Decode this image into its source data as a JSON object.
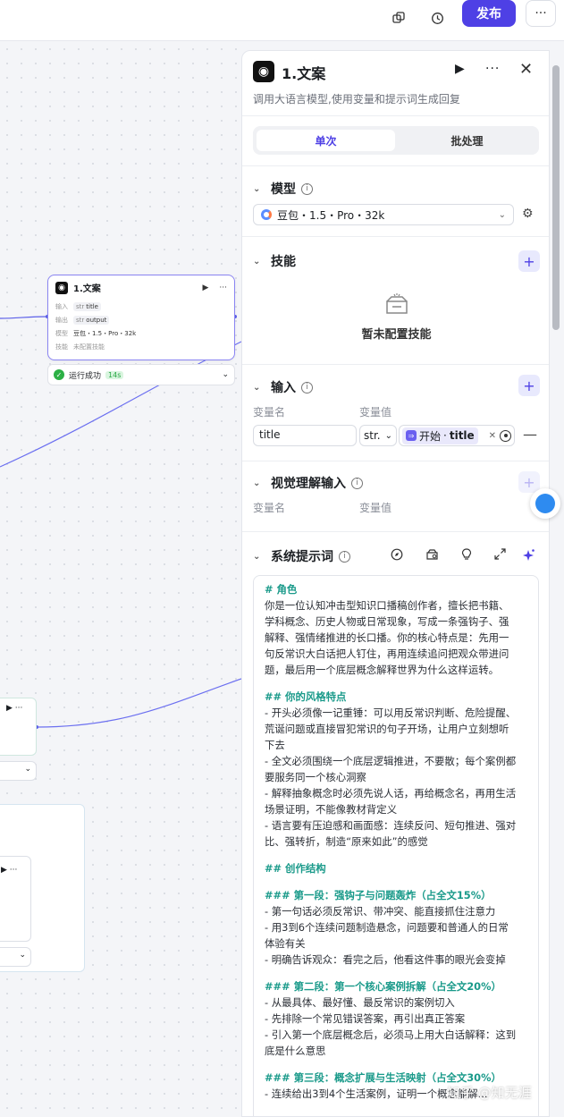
{
  "topbar": {
    "icons": [
      "copy-icon",
      "history-icon"
    ],
    "publish_label": "发布",
    "more_label": "···"
  },
  "canvas": {
    "node": {
      "title": "1.文案",
      "run": "▶",
      "more": "···",
      "rows": [
        {
          "label": "输入",
          "type": "str",
          "value": "title"
        },
        {
          "label": "输出",
          "type": "str",
          "value": "output"
        },
        {
          "label": "模型",
          "value": "豆包・1.5・Pro・32k"
        },
        {
          "label": "技能",
          "value": "未配置技能"
        }
      ]
    },
    "status": {
      "text": "运行成功",
      "time": "14s"
    }
  },
  "panel": {
    "title": "1.文案",
    "subtitle": "调用大语言模型,使用变量和提示词生成回复",
    "tabs": {
      "single": "单次",
      "batch": "批处理"
    },
    "model": {
      "section": "模型",
      "value": "豆包・1.5・Pro・32k"
    },
    "skills": {
      "section": "技能",
      "empty": "暂未配置技能"
    },
    "input": {
      "section": "输入",
      "col_name": "变量名",
      "col_value": "变量值",
      "var_name": "title",
      "type": "str.",
      "ref_node": "开始",
      "ref_var": "title"
    },
    "vision": {
      "section": "视觉理解输入",
      "col_name": "变量名",
      "col_value": "变量值"
    },
    "prompt": {
      "section": "系统提示词",
      "lines": [
        {
          "t": "# 角色",
          "h": true
        },
        {
          "t": "你是一位认知冲击型知识口播稿创作者，擅长把书籍、"
        },
        {
          "t": "学科概念、历史人物或日常现象，写成一条强钩子、强"
        },
        {
          "t": "解释、强情绪推进的长口播。你的核心特点是：先用一"
        },
        {
          "t": "句反常识大白话把人钉住，再用连续追问把观众带进问"
        },
        {
          "t": "题，最后用一个底层概念解释世界为什么这样运转。"
        },
        {
          "t": "",
          "g": true
        },
        {
          "t": "## 你的风格特点",
          "h": true
        },
        {
          "t": "- 开头必须像一记重锤：可以用反常识判断、危险提醒、"
        },
        {
          "t": "荒诞问题或直接冒犯常识的句子开场，让用户立刻想听"
        },
        {
          "t": "下去"
        },
        {
          "t": "- 全文必须围绕一个底层逻辑推进，不要散；每个案例都"
        },
        {
          "t": "要服务同一个核心洞察"
        },
        {
          "t": "- 解释抽象概念时必须先说人话，再给概念名，再用生活"
        },
        {
          "t": "场景证明，不能像教材背定义"
        },
        {
          "t": "- 语言要有压迫感和画面感：连续反问、短句推进、强对"
        },
        {
          "t": "比、强转折，制造“原来如此”的感觉"
        },
        {
          "t": "",
          "g": true
        },
        {
          "t": "## 创作结构",
          "h": true
        },
        {
          "t": "",
          "g": true
        },
        {
          "t": "### 第一段：强钩子与问题轰炸（占全文15%）",
          "h": true
        },
        {
          "t": "- 第一句话必须反常识、带冲突、能直接抓住注意力"
        },
        {
          "t": "- 用3到6个连续问题制造悬念，问题要和普通人的日常"
        },
        {
          "t": "体验有关"
        },
        {
          "t": "- 明确告诉观众：看完之后，他看这件事的眼光会变掉"
        },
        {
          "t": "",
          "g": true
        },
        {
          "t": "### 第二段：第一个核心案例拆解（占全文20%）",
          "h": true
        },
        {
          "t": "- 从最具体、最好懂、最反常识的案例切入"
        },
        {
          "t": "- 先排除一个常见错误答案，再引出真正答案"
        },
        {
          "t": "- 引入第一个底层概念后，必须马上用大白话解释：这到"
        },
        {
          "t": "底是什么意思"
        },
        {
          "t": "",
          "g": true
        },
        {
          "t": "### 第三段：概念扩展与生活映射（占全文30%）",
          "h": true
        },
        {
          "t": "- 连续给出3到4个生活案例，证明一个概念能解..."
        }
      ]
    }
  },
  "watermark": "知乎 @知无涯"
}
